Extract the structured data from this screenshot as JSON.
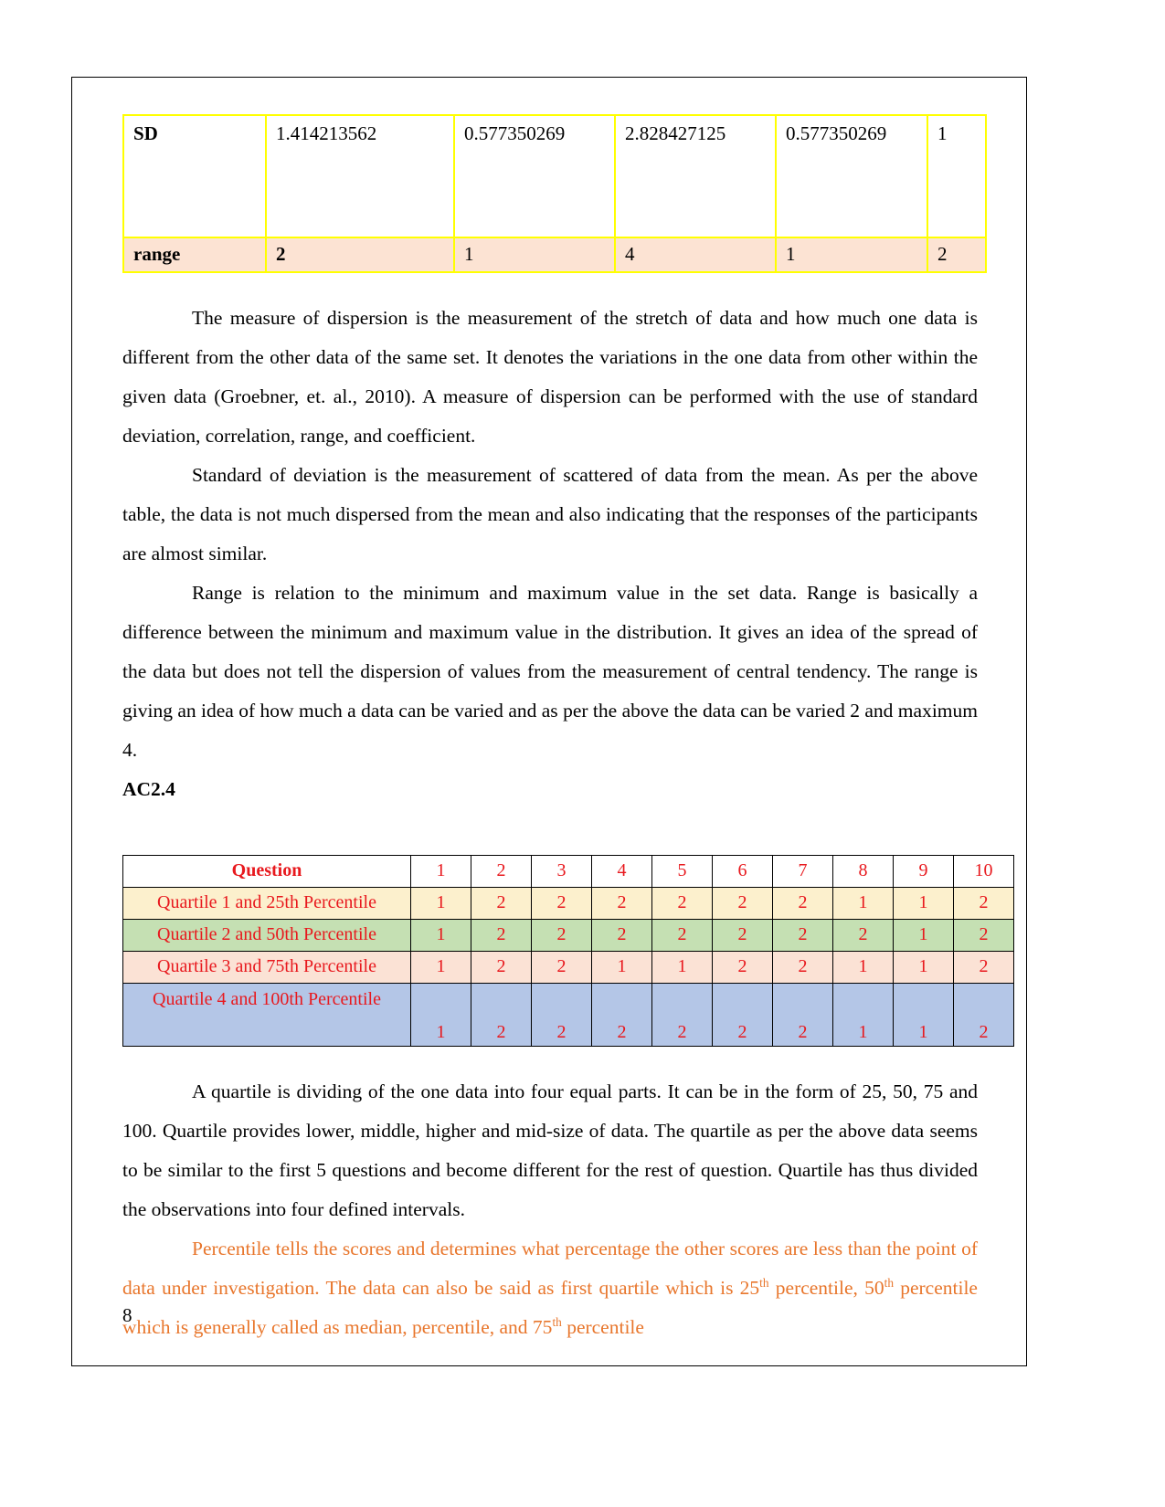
{
  "document": {
    "page_number": "8",
    "heading": "AC2.4",
    "orange_color": "#E8762C",
    "table_red_color": "#E8191E"
  },
  "sd_table": {
    "rows": [
      {
        "name": "sd-row",
        "cells": [
          "SD",
          "1.414213562",
          "0.577350269",
          "2.828427125",
          "0.577350269",
          "1"
        ]
      },
      {
        "name": "range-row",
        "cells": [
          "range",
          "2",
          "1",
          "4",
          "1",
          "2"
        ]
      }
    ]
  },
  "paragraphs": {
    "p1": "The measure of dispersion is the measurement of the stretch of data and how much one data is different from the other data of the same set. It denotes the variations in the one data from other within the given data (Groebner, et. al., 2010). A measure of dispersion can be performed with the use of standard deviation, correlation, range, and coefficient.",
    "p2": "Standard of deviation is the measurement of scattered of data from the mean. As per the above table, the data is not much dispersed from the mean and also indicating that the responses of the participants are almost similar.",
    "p3": "Range is relation to the minimum and maximum value in the set data. Range is basically a difference between the minimum and maximum value in the distribution. It gives an idea of the spread of the data but does not tell the dispersion of values from the measurement of central tendency. The range is giving an idea of how much a data can be varied and as per the above the data can be varied 2 and maximum 4.",
    "p4": "A quartile is dividing of the one data into four equal parts. It can be in the form of 25, 50, 75 and 100. Quartile provides lower, middle, higher and mid-size of data. The quartile as per the above data seems to be similar to the first 5 questions and become different for the rest of question. Quartile has thus divided the observations into four defined intervals.",
    "p5_part1": "Percentile tells the scores and determines what percentage the other scores are less than the point of data under investigation. The data can also be said as first quartile which is 25",
    "p5_sup1": "th",
    "p5_part2": " percentile, 50",
    "p5_sup2": "th",
    "p5_part3": " percentile which is generally called as median, percentile, and 75",
    "p5_sup3": "th",
    "p5_part4": " percentile"
  },
  "quartile_table": {
    "header": {
      "label": "Question",
      "columns": [
        "1",
        "2",
        "3",
        "4",
        "5",
        "6",
        "7",
        "8",
        "9",
        "10"
      ]
    },
    "rows": [
      {
        "label": "Quartile 1 and 25th Percentile",
        "values": [
          "1",
          "2",
          "2",
          "2",
          "2",
          "2",
          "2",
          "1",
          "1",
          "2"
        ]
      },
      {
        "label": "Quartile 2 and 50th Percentile",
        "values": [
          "1",
          "2",
          "2",
          "2",
          "2",
          "2",
          "2",
          "2",
          "1",
          "2"
        ]
      },
      {
        "label": "Quartile 3 and 75th Percentile",
        "values": [
          "1",
          "2",
          "2",
          "1",
          "1",
          "2",
          "2",
          "1",
          "1",
          "2"
        ]
      },
      {
        "label": "Quartile 4 and 100th Percentile",
        "values": [
          "1",
          "2",
          "2",
          "2",
          "2",
          "2",
          "2",
          "1",
          "1",
          "2"
        ]
      }
    ]
  }
}
